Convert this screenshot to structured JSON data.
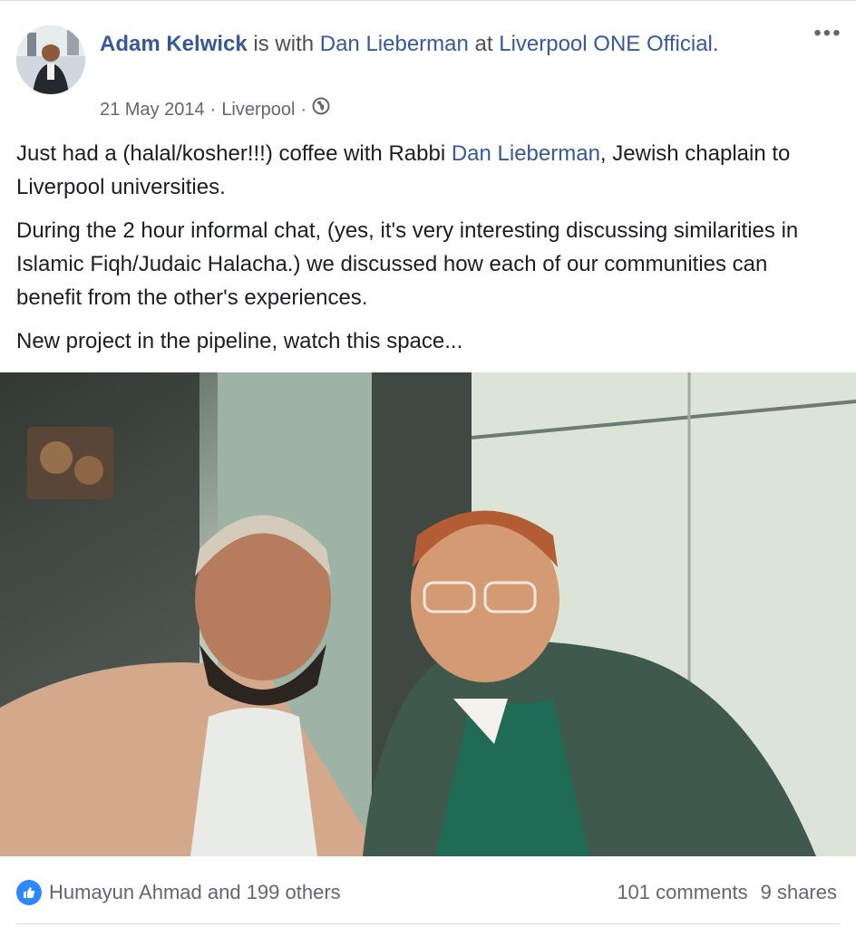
{
  "post": {
    "author": "Adam Kelwick",
    "with_text": " is with ",
    "tagged_person": "Dan Lieberman",
    "at_text": " at ",
    "location_name": "Liverpool ONE Official",
    "period": ".",
    "date": "21 May 2014",
    "sep1": "·",
    "place": "Liverpool",
    "sep2": "·",
    "audience_icon": "globe-icon",
    "more_icon": "more-icon",
    "paragraph1_a": "Just had a (halal/kosher!!!) coffee with Rabbi ",
    "paragraph1_link": "Dan Lieberman",
    "paragraph1_b": ", Jewish chaplain to Liverpool universities.",
    "paragraph2": "During the 2 hour informal chat, (yes, it's very interesting discussing similarities in Islamic Fiqh/Judaic Halacha.) we discussed how each of our communities can benefit from the other's experiences.",
    "paragraph3": "New project in the pipeline, watch this space..."
  },
  "footer": {
    "like_icon": "thumbs-up-icon",
    "likes_text": "Humayun Ahmad and 199 others",
    "comments_text": "101 comments",
    "shares_text": "9 shares"
  },
  "colors": {
    "link": "#385898",
    "like_blue": "#2d88ff",
    "muted": "#616770"
  }
}
